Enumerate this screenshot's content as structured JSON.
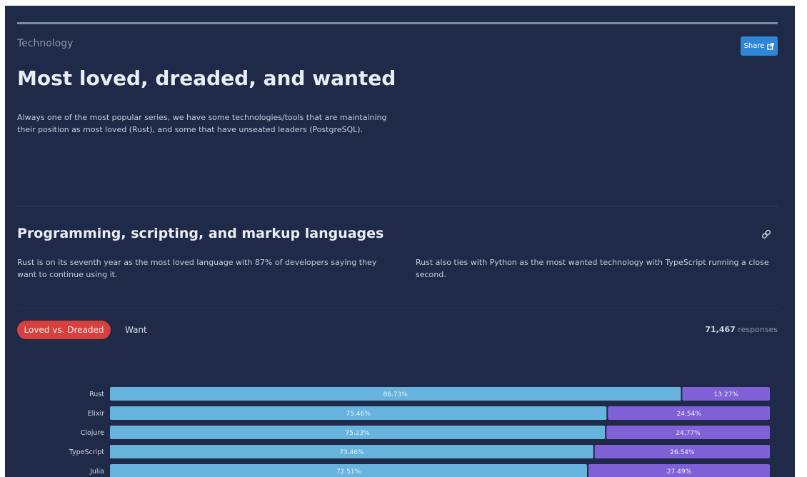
{
  "header": {
    "eyebrow": "Technology",
    "share_label": "Share",
    "title": "Most loved, dreaded, and wanted",
    "description": "Always one of the most popular series, we have some technologies/tools that are maintaining their position as most loved (Rust), and some that have unseated leaders (PostgreSQL)."
  },
  "section": {
    "title": "Programming, scripting, and markup languages",
    "left_text": "Rust is on its seventh year as the most loved language with 87% of developers saying they want to continue using it.",
    "right_text": "Rust also ties with Python as the most wanted technology with TypeScript running a close second."
  },
  "tabs": {
    "active": "Loved vs. Dreaded",
    "other": "Want"
  },
  "responses": {
    "count": "71,467",
    "label": "responses"
  },
  "colors": {
    "background": "#1e2a47",
    "loved": "#66b3de",
    "dreaded": "#7f60d6",
    "accent": "#d8403e",
    "share": "#2f86d6"
  },
  "icons": {
    "share": "external-link-icon",
    "section_link": "link-icon"
  },
  "chart_data": {
    "type": "bar",
    "orientation": "horizontal",
    "stacked": true,
    "categories": [
      "Rust",
      "Elixir",
      "Clojure",
      "TypeScript",
      "Julia"
    ],
    "series": [
      {
        "values": [
          86.73,
          75.46,
          75.23,
          73.46,
          72.51
        ]
      },
      {
        "values": [
          13.27,
          24.54,
          24.77,
          26.54,
          27.49
        ]
      }
    ],
    "data_labels": [
      [
        "86.73%",
        "75.46%",
        "75.23%",
        "73.46%",
        "72.51%"
      ],
      [
        "13.27%",
        "24.54%",
        "24.77%",
        "26.54%",
        "27.49%"
      ]
    ],
    "xlim": [
      0,
      100
    ],
    "legend": "none",
    "grid": false
  }
}
